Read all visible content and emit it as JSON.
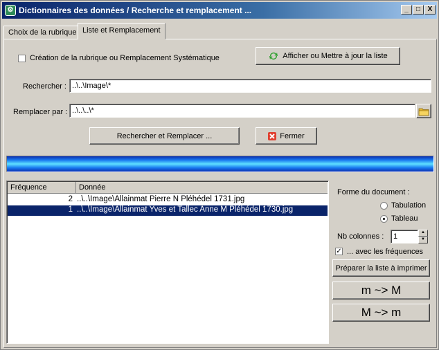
{
  "window": {
    "title": "Dictionnaires des données / Recherche et remplacement ...",
    "minimize": "_",
    "maximize": "□",
    "close": "X"
  },
  "tabs": [
    {
      "label": "Choix de la rubrique"
    },
    {
      "label": "Liste et Remplacement"
    }
  ],
  "options": {
    "creation_checkbox_label": "Création de la rubrique ou Remplacement Systématique",
    "creation_checked": false
  },
  "refresh_button": "Afficher ou Mettre à jour la liste",
  "search": {
    "label": "Rechercher :",
    "value": "..\\..\\Image\\*"
  },
  "replace": {
    "label": "Remplacer par :",
    "value": "..\\..\\..\\*"
  },
  "actions": {
    "search_replace": "Rechercher et Remplacer ...",
    "close": "Fermer"
  },
  "progress": 1.0,
  "list": {
    "columns": [
      "Fréquence",
      "Donnée"
    ],
    "rows": [
      {
        "freq": "2",
        "data": "..\\..\\Image\\Allainmat Pierre N Pléhédel 1731.jpg",
        "selected": false
      },
      {
        "freq": "1",
        "data": "..\\..\\Image\\Allainmat Yves et Tallec Anne M Pléhédel 1730.jpg",
        "selected": true
      }
    ]
  },
  "document": {
    "label": "Forme du document :",
    "options": [
      "Tabulation",
      "Tableau"
    ],
    "selected": "Tableau",
    "nb_columns_label": "Nb colonnes :",
    "nb_columns": "1",
    "with_freq_label": "... avec les fréquences",
    "with_freq_checked": true,
    "prepare_button": "Préparer la liste à imprimer",
    "lower_upper_button": "m ~> M",
    "upper_lower_button": "M ~> m"
  }
}
